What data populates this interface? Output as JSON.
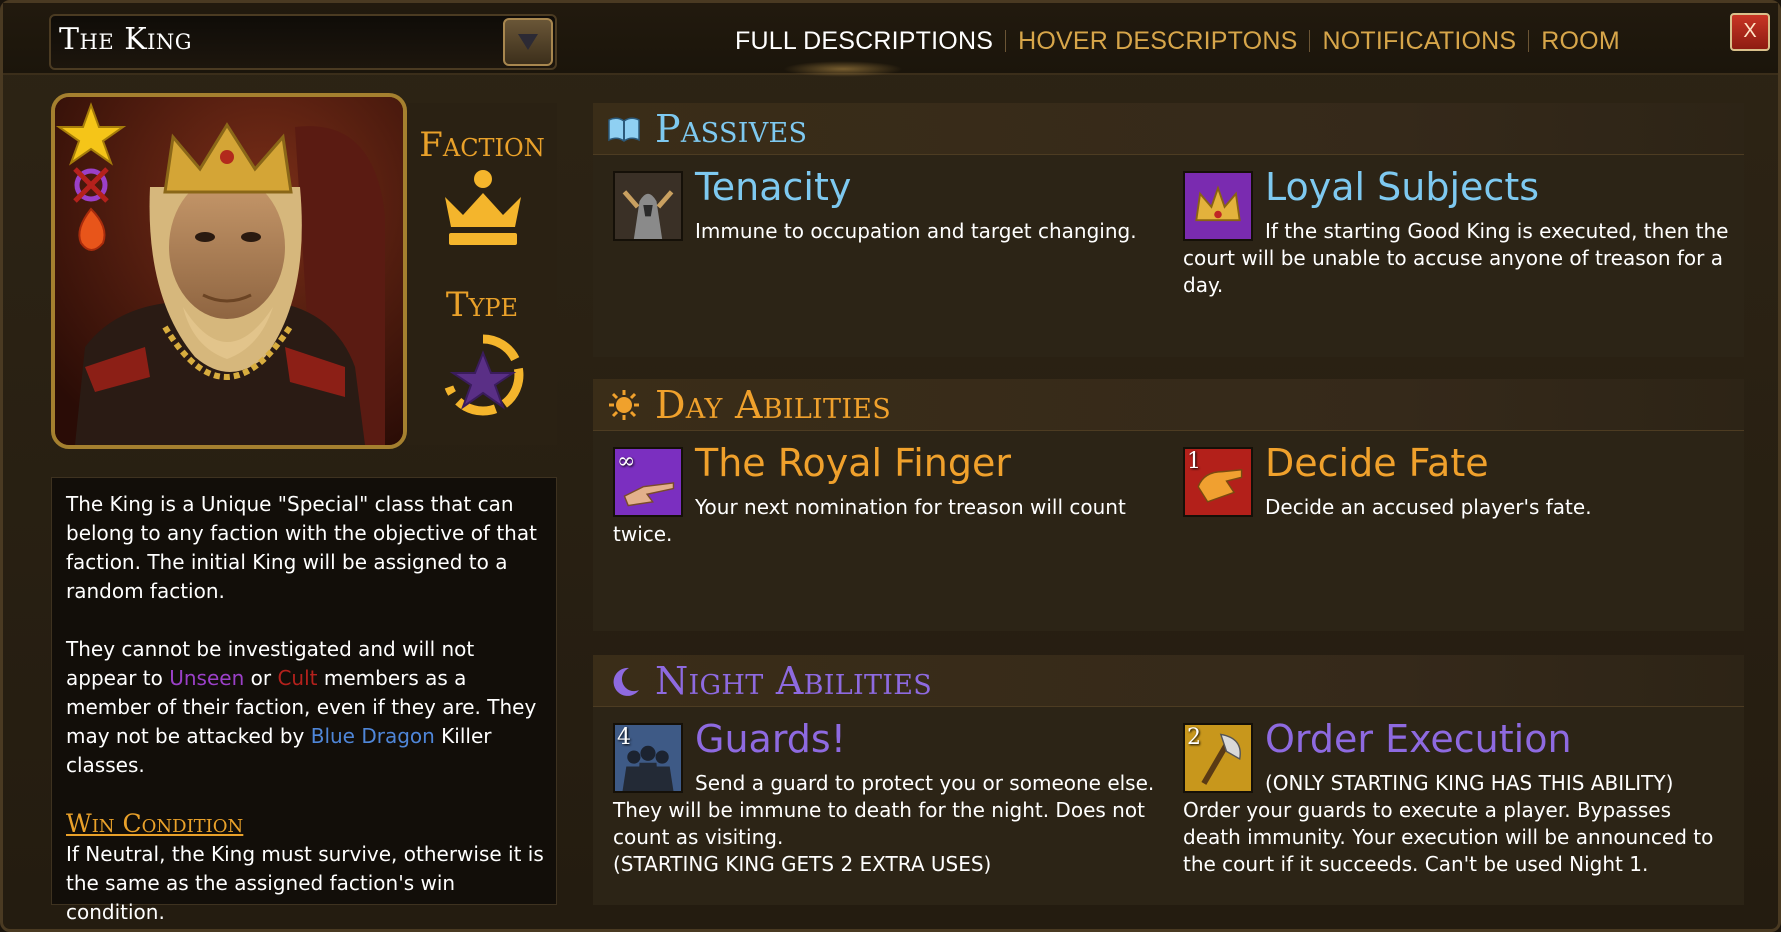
{
  "header": {
    "class_title": "The King",
    "tabs": [
      {
        "label": "FULL DESCRIPTIONS",
        "active": true
      },
      {
        "label": "HOVER DESCRIPTONS",
        "active": false
      },
      {
        "label": "NOTIFICATIONS",
        "active": false
      },
      {
        "label": "ROOM",
        "active": false
      }
    ],
    "close_label": "X"
  },
  "character": {
    "faction_label": "Faction",
    "type_label": "Type",
    "description_p1": "The King is a Unique \"Special\" class that can belong to any faction with the objective of that faction. The initial King will be assigned to a random faction.",
    "description_p2_a": "They cannot be investigated and will not appear to ",
    "unseen": "Unseen",
    "or": " or ",
    "cult": "Cult",
    "description_p2_b": " members as a member of their faction, even if they are. They may not be attacked by ",
    "blue_dragon": "Blue Dragon",
    "description_p2_c": " Killer classes.",
    "win_title": "Win Condition",
    "win_text": "If Neutral, the King must survive, otherwise it is the same as the assigned faction's win condition."
  },
  "sections": {
    "passives": {
      "title": "Passives",
      "abilities": [
        {
          "name": "Tenacity",
          "desc": "Immune to occupation and target changing."
        },
        {
          "name": "Loyal Subjects",
          "desc": "If the starting Good King is executed, then the court will be unable to accuse anyone of treason for a day."
        }
      ]
    },
    "day": {
      "title": "Day Abilities",
      "abilities": [
        {
          "name": "The Royal Finger",
          "desc": "Your next nomination for treason will count twice.",
          "uses": "∞"
        },
        {
          "name": "Decide Fate",
          "desc": "Decide an accused player's fate.",
          "uses": "1"
        }
      ]
    },
    "night": {
      "title": "Night Abilities",
      "abilities": [
        {
          "name": "Guards!",
          "desc": "Send a guard to protect you or someone else. They will be immune to death for the night. Does not count as visiting.",
          "note": "(STARTING KING GETS 2 EXTRA USES)",
          "uses": "4"
        },
        {
          "name": "Order Execution",
          "lead": "(ONLY STARTING KING HAS THIS ABILITY)",
          "desc": "Order your guards to execute a player. Bypasses death immunity. Your execution will be announced to the court if it succeeds. Can't be used Night 1.",
          "uses": "2"
        }
      ]
    }
  },
  "colors": {
    "accent_gold": "#e9a12a",
    "passive_blue": "#7ec9f0",
    "night_purple": "#8e6ae0",
    "unseen": "#9b40c8",
    "cult": "#b4211c",
    "blue_dragon": "#4f86d8"
  }
}
